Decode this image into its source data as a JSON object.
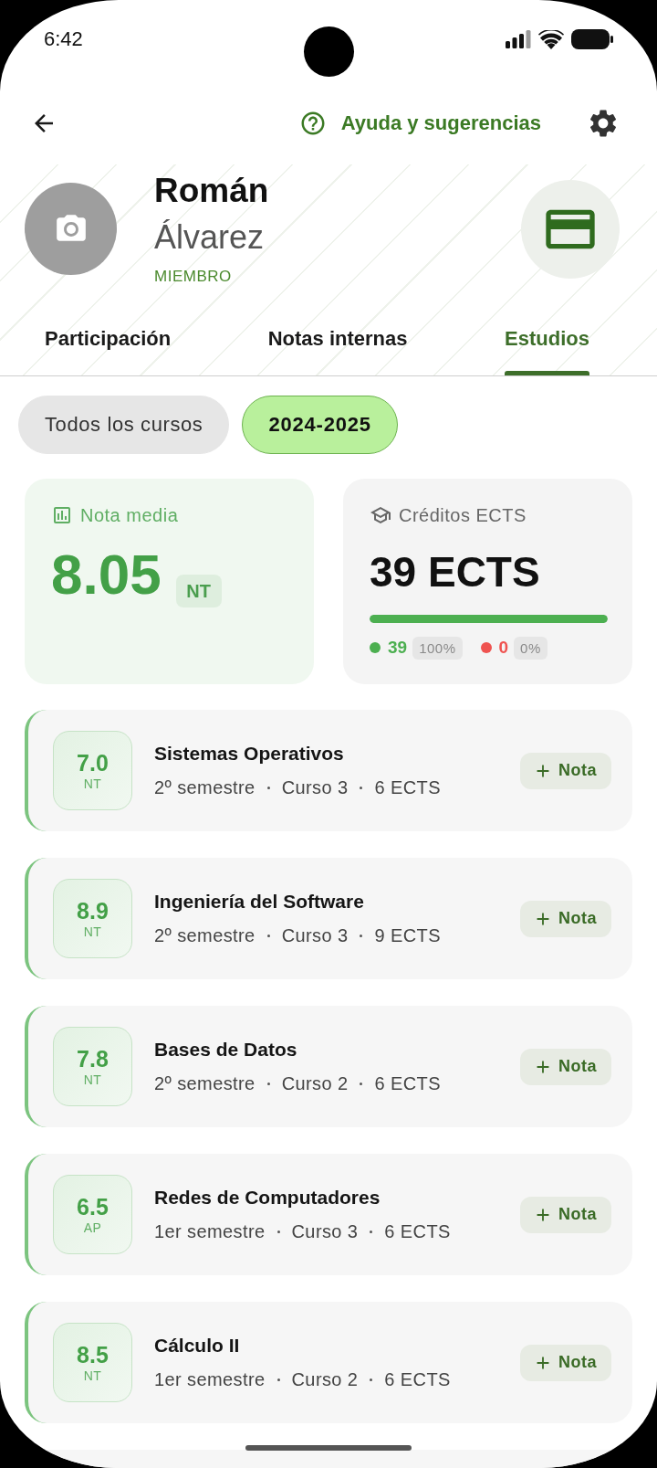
{
  "status_bar": {
    "time": "6:42"
  },
  "toolbar": {
    "help_link": "Ayuda y sugerencias"
  },
  "profile": {
    "first_name": "Román",
    "last_name": "Álvarez",
    "role": "MIEMBRO"
  },
  "tabs": [
    {
      "label": "Participación",
      "selected": false
    },
    {
      "label": "Notas internas",
      "selected": false
    },
    {
      "label": "Estudios",
      "selected": true
    }
  ],
  "filters": [
    {
      "label": "Todos los cursos",
      "selected": false
    },
    {
      "label": "2024-2025",
      "selected": true
    }
  ],
  "stats": [
    {
      "kind": "average",
      "label": "Nota media",
      "value": "8.05",
      "badge": "NT"
    },
    {
      "kind": "credits",
      "label": "Créditos ECTS",
      "value": "39 ECTS",
      "level": 1,
      "legend": [
        {
          "count": "39",
          "percent": "100%",
          "color": "#4caf50"
        },
        {
          "count": "0",
          "percent": "0%",
          "color": "#ef5350"
        }
      ]
    }
  ],
  "courses": [
    {
      "grade": "7.0",
      "grade_label": "NT",
      "title": "Sistemas Operativos",
      "details": [
        "2º semestre",
        "Curso 3",
        "6 ECTS"
      ],
      "action": "Nota"
    },
    {
      "grade": "8.9",
      "grade_label": "NT",
      "title": "Ingeniería del Software",
      "details": [
        "2º semestre",
        "Curso 3",
        "9 ECTS"
      ],
      "action": "Nota"
    },
    {
      "grade": "7.8",
      "grade_label": "NT",
      "title": "Bases de Datos",
      "details": [
        "2º semestre",
        "Curso 2",
        "6 ECTS"
      ],
      "action": "Nota"
    },
    {
      "grade": "6.5",
      "grade_label": "AP",
      "title": "Redes de Computadores",
      "details": [
        "1er semestre",
        "Curso 3",
        "6 ECTS"
      ],
      "action": "Nota"
    },
    {
      "grade": "8.5",
      "grade_label": "NT",
      "title": "Cálculo II",
      "details": [
        "1er semestre",
        "Curso 2",
        "6 ECTS"
      ],
      "action": "Nota"
    }
  ]
}
